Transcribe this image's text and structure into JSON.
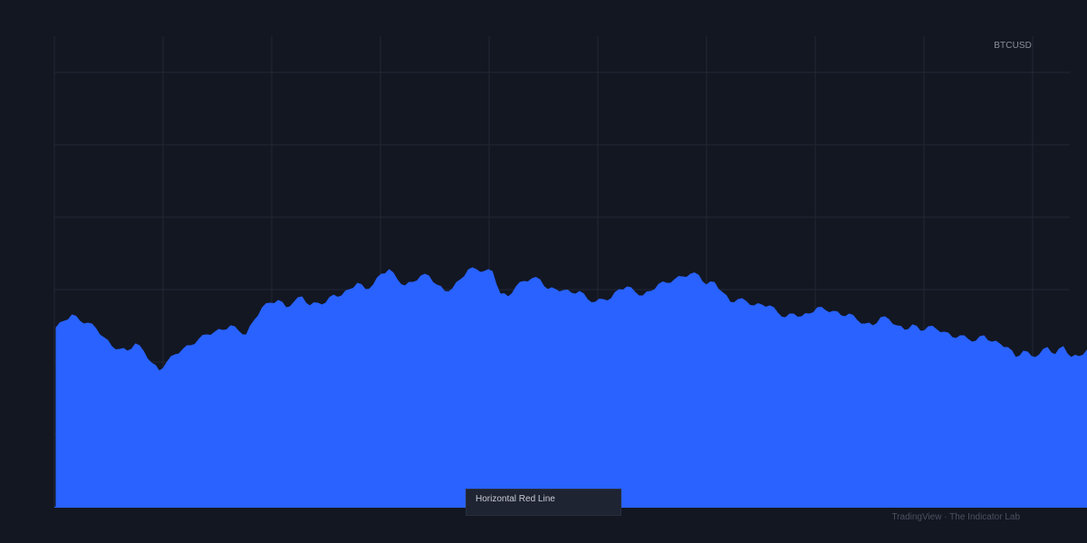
{
  "chart_data": {
    "type": "area",
    "title": "",
    "xlabel": "",
    "ylabel": "",
    "grid": true,
    "legend_position": "bottom-center",
    "series": [
      {
        "name": "BTCUSD",
        "color": "#2962ff",
        "values": [
          198,
          205,
          212,
          205,
          203,
          197,
          187,
          177,
          174,
          172,
          180,
          172,
          159,
          150,
          160,
          168,
          174,
          178,
          185,
          190,
          193,
          195,
          200,
          194,
          190,
          206,
          220,
          225,
          228,
          220,
          226,
          232,
          222,
          225,
          225,
          234,
          233,
          240,
          247,
          240,
          245,
          257,
          262,
          251,
          244,
          248,
          255,
          255,
          245,
          238,
          241,
          251,
          262,
          262,
          260,
          260,
          235,
          232,
          243,
          249,
          252,
          251,
          240,
          240,
          239,
          236,
          238,
          229,
          226,
          229,
          230,
          240,
          243,
          237,
          233,
          238,
          246,
          247,
          251,
          254,
          257,
          256,
          245,
          248,
          237,
          226,
          229,
          227,
          222,
          223,
          222,
          214,
          209,
          213,
          210,
          213,
          220,
          217,
          216,
          211,
          213,
          206,
          202,
          200,
          209,
          207,
          200,
          195,
          201,
          194,
          199,
          196,
          193,
          187,
          189,
          185,
          183,
          189,
          182,
          180,
          176,
          165,
          172,
          166,
          168,
          176,
          168,
          177,
          165,
          166,
          173
        ]
      }
    ],
    "ylim": [
      0,
      520
    ],
    "y_ticks": [
      0,
      80,
      160,
      240,
      320,
      400,
      480
    ],
    "x_tick_count": 10
  },
  "symbol": "BTCUSD",
  "legend": {
    "label": "Horizontal Red Line"
  },
  "attribution": "TradingView · The Indicator Lab",
  "colors": {
    "background": "#131722",
    "grid": "#232735",
    "area": "#2962ff",
    "baseline_red": "#f23645"
  }
}
